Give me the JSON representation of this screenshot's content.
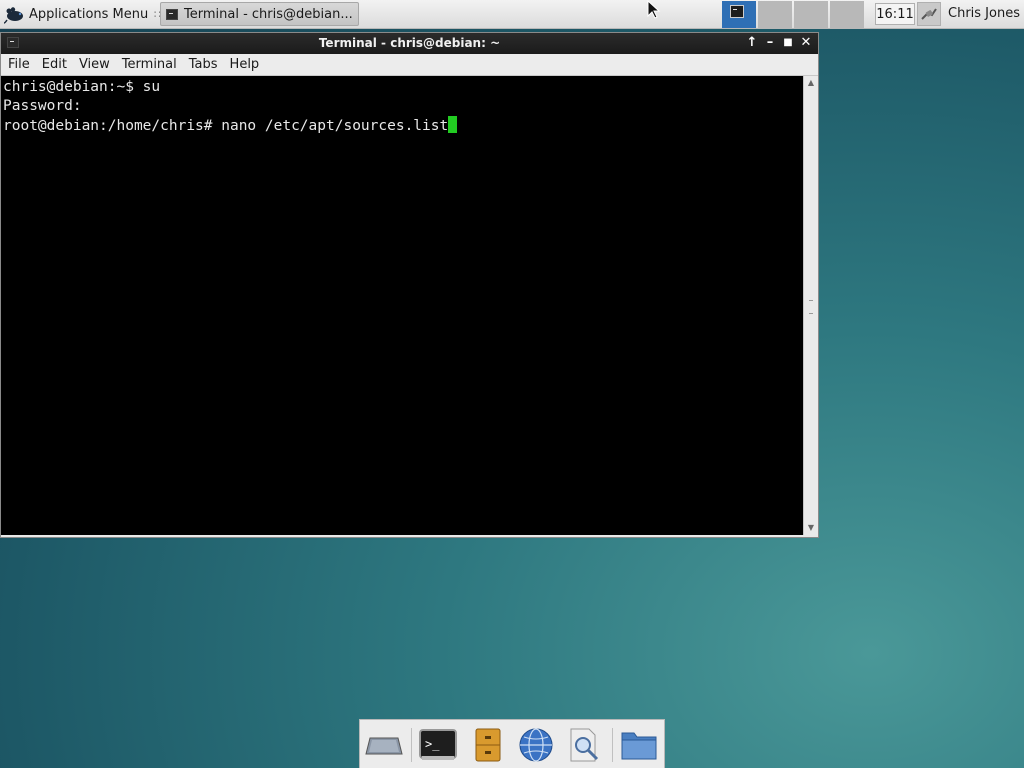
{
  "top_panel": {
    "apps_menu_label": "Applications Menu",
    "separator": "∷",
    "task_label": "Terminal - chris@debian...",
    "clock": "16:11",
    "user_name": "Chris Jones"
  },
  "terminal": {
    "title": "Terminal - chris@debian: ~",
    "menu": [
      "File",
      "Edit",
      "View",
      "Terminal",
      "Tabs",
      "Help"
    ],
    "lines": [
      "chris@debian:~$ su",
      "Password:",
      "root@debian:/home/chris# nano /etc/apt/sources.list"
    ],
    "window_controls": {
      "shade": "↑",
      "minimize": "–",
      "maximize": "■",
      "close": "✕"
    }
  },
  "colors": {
    "cursor": "#22cc22",
    "terminal_bg": "#000000",
    "title_bar": "#222222",
    "active_workspace": "#2f6fb5"
  },
  "dock": {
    "items": [
      "show-desktop-icon",
      "terminal-icon",
      "file-cabinet-icon",
      "web-browser-icon",
      "app-finder-icon",
      "folder-icon"
    ]
  }
}
